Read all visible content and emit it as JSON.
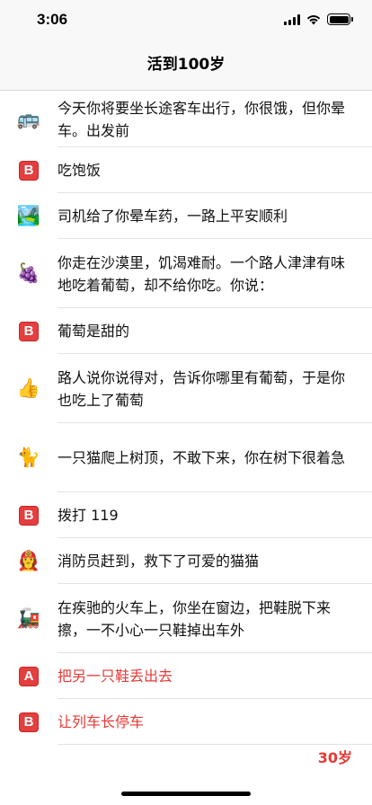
{
  "status_bar": {
    "time": "3:06"
  },
  "nav": {
    "title": "活到100岁"
  },
  "rows": [
    {
      "icon": "bus-icon",
      "glyph": "🚌",
      "type": "emoji",
      "text": "今天你将要坐长途客车出行，你很饿，但你晕车。出发前",
      "red": false
    },
    {
      "icon": "b-button-icon",
      "glyph": "B",
      "type": "badge",
      "text": "吃饱饭",
      "red": false
    },
    {
      "icon": "landscape-icon",
      "glyph": "🏞️",
      "type": "emoji",
      "text": "司机给了你晕车药，一路上平安顺利",
      "red": false
    },
    {
      "icon": "grapes-icon",
      "glyph": "🍇",
      "type": "emoji",
      "text": "你走在沙漠里，饥渴难耐。一个路人津津有味地吃着葡萄，却不给你吃。你说：",
      "red": false
    },
    {
      "icon": "b-button-icon",
      "glyph": "B",
      "type": "badge",
      "text": "葡萄是甜的",
      "red": false
    },
    {
      "icon": "thumbs-up-icon",
      "glyph": "👍",
      "type": "emoji",
      "text": "路人说你说得对，告诉你哪里有葡萄，于是你也吃上了葡萄",
      "red": false
    },
    {
      "icon": "cat-icon",
      "glyph": "🐈",
      "type": "emoji",
      "text": "一只猫爬上树顶，不敢下来，你在树下很着急",
      "red": false
    },
    {
      "icon": "b-button-icon",
      "glyph": "B",
      "type": "badge",
      "text": "拨打 119",
      "red": false
    },
    {
      "icon": "firefighter-icon",
      "glyph": "👩‍🚒",
      "type": "emoji",
      "text": "消防员赶到，救下了可爱的猫猫",
      "red": false
    },
    {
      "icon": "locomotive-icon",
      "glyph": "🚂",
      "type": "emoji",
      "text": "在疾驰的火车上，你坐在窗边，把鞋脱下来擦，一不小心一只鞋掉出车外",
      "red": false
    },
    {
      "icon": "a-button-icon",
      "glyph": "A",
      "type": "badge",
      "text": "把另一只鞋丢出去",
      "red": true
    },
    {
      "icon": "b-button-icon",
      "glyph": "B",
      "type": "badge",
      "text": "让列车长停车",
      "red": true
    }
  ],
  "footer": {
    "age": "30岁"
  },
  "colors": {
    "accent_red": "#e53935",
    "badge_red": "#e53e3e"
  }
}
